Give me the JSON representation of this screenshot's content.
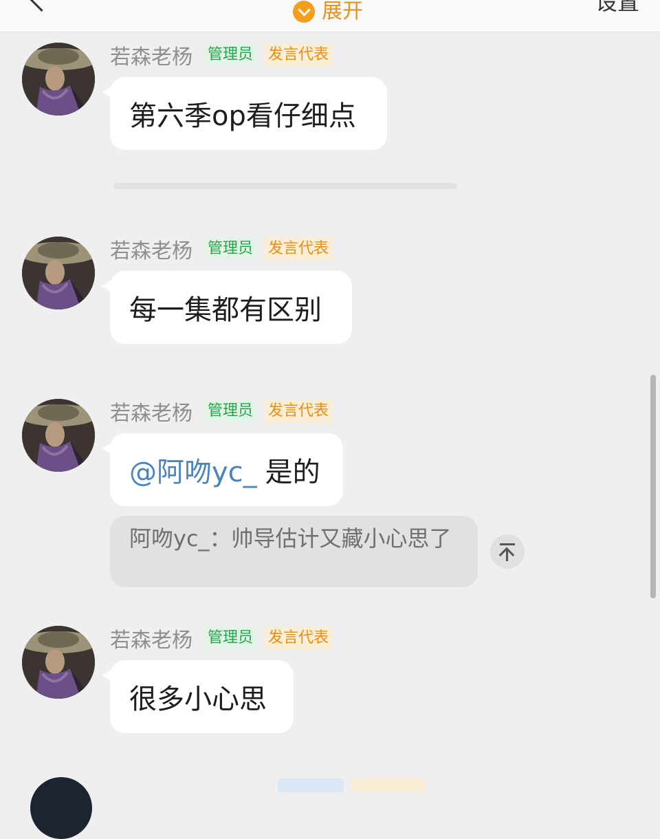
{
  "header": {
    "expand_label": "展开",
    "settings_label": "设置"
  },
  "messages": [
    {
      "sender": "若森老杨",
      "badge_admin": "管理员",
      "badge_rep": "发言代表",
      "text": "第六季op看仔细点"
    },
    {
      "sender": "若森老杨",
      "badge_admin": "管理员",
      "badge_rep": "发言代表",
      "text": "每一集都有区别"
    },
    {
      "sender": "若森老杨",
      "badge_admin": "管理员",
      "badge_rep": "发言代表",
      "mention": "@阿吻yc_",
      "text": "是的",
      "quote": {
        "author": "阿吻yc_：",
        "text": "帅导估计又藏小心思了"
      }
    },
    {
      "sender": "若森老杨",
      "badge_admin": "管理员",
      "badge_rep": "发言代表",
      "text": "很多小心思"
    }
  ],
  "icons": {
    "back": "chevron-left-icon",
    "expand": "chevron-down-circle-icon",
    "scroll_top": "arrow-up-to-top-icon"
  },
  "colors": {
    "accent": "#f59e1b",
    "admin_badge_text": "#22a84a",
    "rep_badge_text": "#eb8f0d",
    "mention": "#4a83bd",
    "background": "#efefef"
  }
}
